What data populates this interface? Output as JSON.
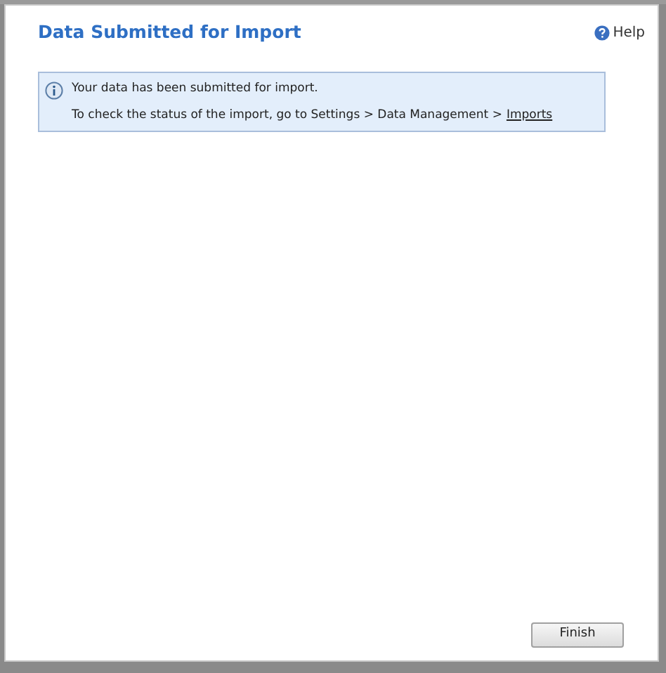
{
  "dialog": {
    "title": "Data Submitted for Import",
    "help": "Help"
  },
  "message": {
    "line_1": "Your data has been submitted for import.",
    "line_2": "To check the status of the import, go to Settings > Data Management >",
    "link": "Imports"
  },
  "buttons": [
    {
      "label": "Finish"
    }
  ]
}
